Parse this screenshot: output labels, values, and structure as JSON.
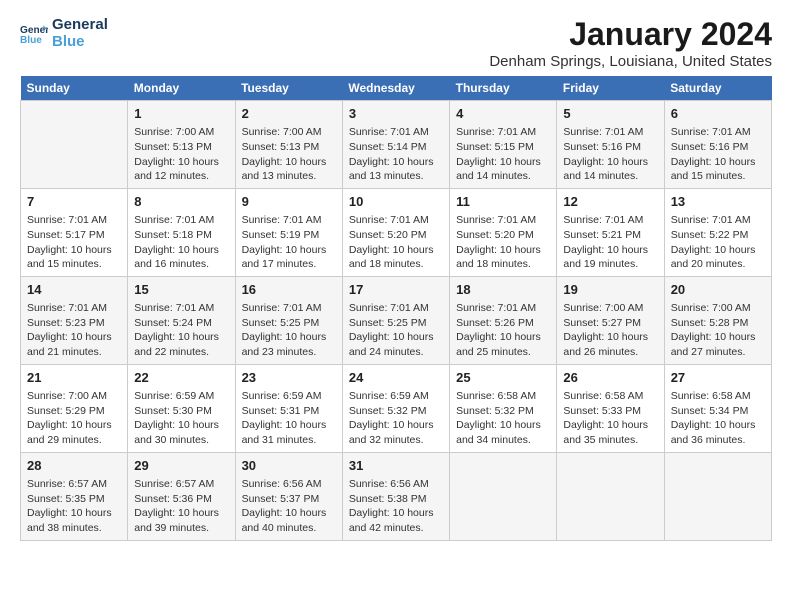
{
  "logo": {
    "line1": "General",
    "line2": "Blue",
    "icon_color": "#4a9fd4"
  },
  "title": "January 2024",
  "location": "Denham Springs, Louisiana, United States",
  "days_of_week": [
    "Sunday",
    "Monday",
    "Tuesday",
    "Wednesday",
    "Thursday",
    "Friday",
    "Saturday"
  ],
  "weeks": [
    [
      {
        "num": "",
        "info": ""
      },
      {
        "num": "1",
        "info": "Sunrise: 7:00 AM\nSunset: 5:13 PM\nDaylight: 10 hours\nand 12 minutes."
      },
      {
        "num": "2",
        "info": "Sunrise: 7:00 AM\nSunset: 5:13 PM\nDaylight: 10 hours\nand 13 minutes."
      },
      {
        "num": "3",
        "info": "Sunrise: 7:01 AM\nSunset: 5:14 PM\nDaylight: 10 hours\nand 13 minutes."
      },
      {
        "num": "4",
        "info": "Sunrise: 7:01 AM\nSunset: 5:15 PM\nDaylight: 10 hours\nand 14 minutes."
      },
      {
        "num": "5",
        "info": "Sunrise: 7:01 AM\nSunset: 5:16 PM\nDaylight: 10 hours\nand 14 minutes."
      },
      {
        "num": "6",
        "info": "Sunrise: 7:01 AM\nSunset: 5:16 PM\nDaylight: 10 hours\nand 15 minutes."
      }
    ],
    [
      {
        "num": "7",
        "info": "Sunrise: 7:01 AM\nSunset: 5:17 PM\nDaylight: 10 hours\nand 15 minutes."
      },
      {
        "num": "8",
        "info": "Sunrise: 7:01 AM\nSunset: 5:18 PM\nDaylight: 10 hours\nand 16 minutes."
      },
      {
        "num": "9",
        "info": "Sunrise: 7:01 AM\nSunset: 5:19 PM\nDaylight: 10 hours\nand 17 minutes."
      },
      {
        "num": "10",
        "info": "Sunrise: 7:01 AM\nSunset: 5:20 PM\nDaylight: 10 hours\nand 18 minutes."
      },
      {
        "num": "11",
        "info": "Sunrise: 7:01 AM\nSunset: 5:20 PM\nDaylight: 10 hours\nand 18 minutes."
      },
      {
        "num": "12",
        "info": "Sunrise: 7:01 AM\nSunset: 5:21 PM\nDaylight: 10 hours\nand 19 minutes."
      },
      {
        "num": "13",
        "info": "Sunrise: 7:01 AM\nSunset: 5:22 PM\nDaylight: 10 hours\nand 20 minutes."
      }
    ],
    [
      {
        "num": "14",
        "info": "Sunrise: 7:01 AM\nSunset: 5:23 PM\nDaylight: 10 hours\nand 21 minutes."
      },
      {
        "num": "15",
        "info": "Sunrise: 7:01 AM\nSunset: 5:24 PM\nDaylight: 10 hours\nand 22 minutes."
      },
      {
        "num": "16",
        "info": "Sunrise: 7:01 AM\nSunset: 5:25 PM\nDaylight: 10 hours\nand 23 minutes."
      },
      {
        "num": "17",
        "info": "Sunrise: 7:01 AM\nSunset: 5:25 PM\nDaylight: 10 hours\nand 24 minutes."
      },
      {
        "num": "18",
        "info": "Sunrise: 7:01 AM\nSunset: 5:26 PM\nDaylight: 10 hours\nand 25 minutes."
      },
      {
        "num": "19",
        "info": "Sunrise: 7:00 AM\nSunset: 5:27 PM\nDaylight: 10 hours\nand 26 minutes."
      },
      {
        "num": "20",
        "info": "Sunrise: 7:00 AM\nSunset: 5:28 PM\nDaylight: 10 hours\nand 27 minutes."
      }
    ],
    [
      {
        "num": "21",
        "info": "Sunrise: 7:00 AM\nSunset: 5:29 PM\nDaylight: 10 hours\nand 29 minutes."
      },
      {
        "num": "22",
        "info": "Sunrise: 6:59 AM\nSunset: 5:30 PM\nDaylight: 10 hours\nand 30 minutes."
      },
      {
        "num": "23",
        "info": "Sunrise: 6:59 AM\nSunset: 5:31 PM\nDaylight: 10 hours\nand 31 minutes."
      },
      {
        "num": "24",
        "info": "Sunrise: 6:59 AM\nSunset: 5:32 PM\nDaylight: 10 hours\nand 32 minutes."
      },
      {
        "num": "25",
        "info": "Sunrise: 6:58 AM\nSunset: 5:32 PM\nDaylight: 10 hours\nand 34 minutes."
      },
      {
        "num": "26",
        "info": "Sunrise: 6:58 AM\nSunset: 5:33 PM\nDaylight: 10 hours\nand 35 minutes."
      },
      {
        "num": "27",
        "info": "Sunrise: 6:58 AM\nSunset: 5:34 PM\nDaylight: 10 hours\nand 36 minutes."
      }
    ],
    [
      {
        "num": "28",
        "info": "Sunrise: 6:57 AM\nSunset: 5:35 PM\nDaylight: 10 hours\nand 38 minutes."
      },
      {
        "num": "29",
        "info": "Sunrise: 6:57 AM\nSunset: 5:36 PM\nDaylight: 10 hours\nand 39 minutes."
      },
      {
        "num": "30",
        "info": "Sunrise: 6:56 AM\nSunset: 5:37 PM\nDaylight: 10 hours\nand 40 minutes."
      },
      {
        "num": "31",
        "info": "Sunrise: 6:56 AM\nSunset: 5:38 PM\nDaylight: 10 hours\nand 42 minutes."
      },
      {
        "num": "",
        "info": ""
      },
      {
        "num": "",
        "info": ""
      },
      {
        "num": "",
        "info": ""
      }
    ]
  ]
}
